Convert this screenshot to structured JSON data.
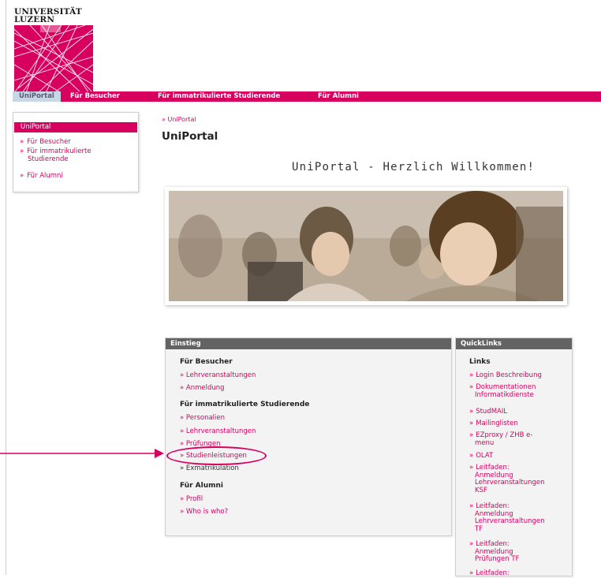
{
  "logo": {
    "line1": "UNIVERSITÄT",
    "line2": "LUZERN"
  },
  "topnav": {
    "tabs": [
      {
        "label": "UniPortal",
        "active": true
      },
      {
        "label": "Für Besucher",
        "active": false
      },
      {
        "label": "Für immatrikulierte Studierende",
        "active": false
      },
      {
        "label": "Für Alumni",
        "active": false
      }
    ]
  },
  "leftmenu": {
    "active": "UniPortal",
    "items": [
      {
        "label": "Für Besucher"
      },
      {
        "label": "Für immatrikulierte Studierende"
      },
      {
        "label": "Für Alumni"
      }
    ]
  },
  "raquo": "»",
  "breadcrumb": "» UniPortal",
  "page_title": "UniPortal",
  "welcome": "UniPortal - Herzlich Willkommen!",
  "einstieg": {
    "title": "Einstieg",
    "sections": [
      {
        "heading": "Für Besucher",
        "links": [
          "» Lehrveranstaltungen",
          "» Anmeldung"
        ]
      },
      {
        "heading": "Für immatrikulierte Studierende",
        "links": [
          "» Personalien",
          "» Lehrveranstaltungen",
          "» Prüfungen",
          "» Studienleistungen",
          "» Exmatrikulation"
        ]
      },
      {
        "heading": "Für Alumni",
        "links": [
          "» Profil",
          "» Who is who?"
        ]
      }
    ]
  },
  "quicklinks": {
    "title": "QuickLinks",
    "heading": "Links",
    "links": [
      [
        "Login Beschreibung"
      ],
      [
        "Dokumentationen",
        "Informatikdienste"
      ],
      [
        "StudMAIL"
      ],
      [
        "Mailinglisten"
      ],
      [
        "EZproxy / ZHB e-",
        "menu"
      ],
      [
        "OLAT"
      ],
      [
        "Leitfaden:",
        "Anmeldung",
        "Lehrveranstaltungen",
        "KSF"
      ],
      [
        "Leitfaden:",
        "Anmeldung",
        "Lehrveranstaltungen",
        "TF"
      ],
      [
        "Leitfaden:",
        "Anmeldung",
        "Prüfungen TF"
      ],
      [
        "Leitfaden:"
      ]
    ]
  },
  "colors": {
    "brand": "#d8005f",
    "header_gray": "#636363",
    "active_tab": "#c8d7e6"
  }
}
